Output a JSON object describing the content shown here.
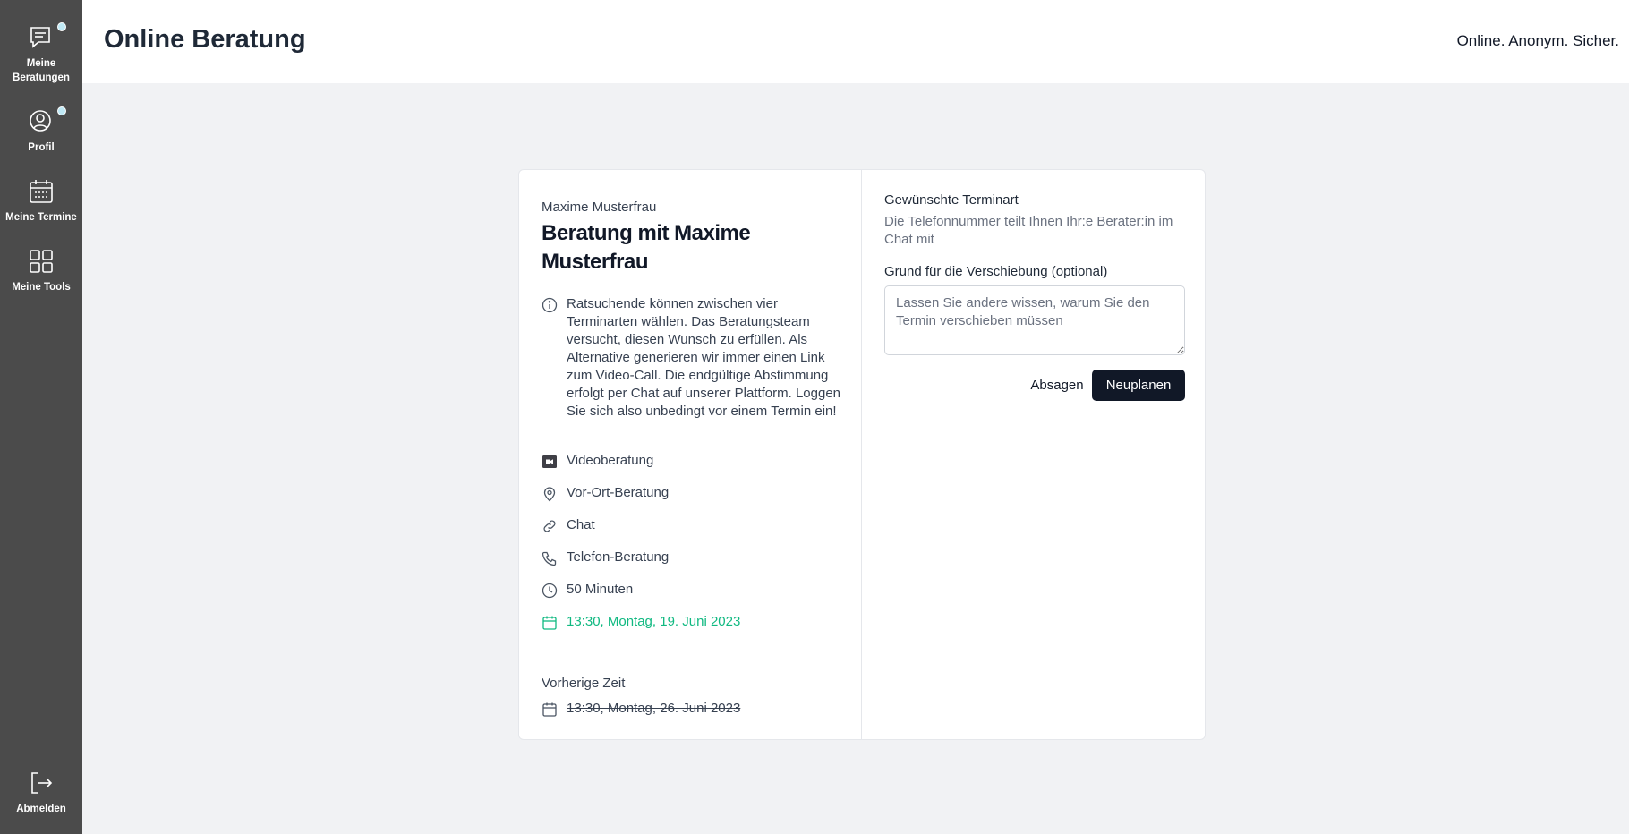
{
  "sidebar": {
    "items": [
      {
        "label_line1": "Meine",
        "label_line2": "Beratungen",
        "icon": "chat-message-icon",
        "notification": true
      },
      {
        "label": "Profil",
        "icon": "user-circle-icon",
        "notification": true
      },
      {
        "label": "Meine Termine",
        "icon": "calendar-icon"
      },
      {
        "label": "Meine Tools",
        "icon": "grid-icon"
      }
    ],
    "logout": {
      "label": "Abmelden",
      "icon": "logout-icon"
    },
    "notification_color": "#bfe9f5"
  },
  "header": {
    "title": "Online Beratung",
    "tagline": "Online. Anonym. Sicher."
  },
  "booking": {
    "organizer": "Maxime Musterfrau",
    "title": "Beratung mit Maxime Musterfrau",
    "info": "Ratsuchende können zwischen vier Terminarten wählen. Das Beratungsteam versucht, diesen Wunsch zu erfüllen. Als Alternative generieren wir immer einen Link zum Video-Call. Die endgültige Abstimmung erfolgt per Chat auf unserer Plattform. Loggen Sie sich also unbedingt vor einem Termin ein!",
    "types": [
      {
        "label": "Videoberatung",
        "icon": "video-icon"
      },
      {
        "label": "Vor-Ort-Beratung",
        "icon": "location-pin-icon"
      },
      {
        "label": "Chat",
        "icon": "link-icon"
      },
      {
        "label": "Telefon-Beratung",
        "icon": "phone-icon"
      }
    ],
    "duration": "50 Minuten",
    "new_time": "13:30, Montag, 19. Juni 2023",
    "previous_label": "Vorherige Zeit",
    "previous_time": "13:30, Montag, 26. Juni 2023",
    "accent_color": "#10b981"
  },
  "form": {
    "type_title": "Gewünschte Terminart",
    "type_subtitle": "Die Telefonnummer teilt Ihnen Ihr:e Berater:in im Chat mit",
    "reason_label": "Grund für die Verschiebung (optional)",
    "reason_placeholder": "Lassen Sie andere wissen, warum Sie den Termin verschieben müssen",
    "reason_value": "",
    "cancel_label": "Absagen",
    "submit_label": "Neuplanen"
  }
}
